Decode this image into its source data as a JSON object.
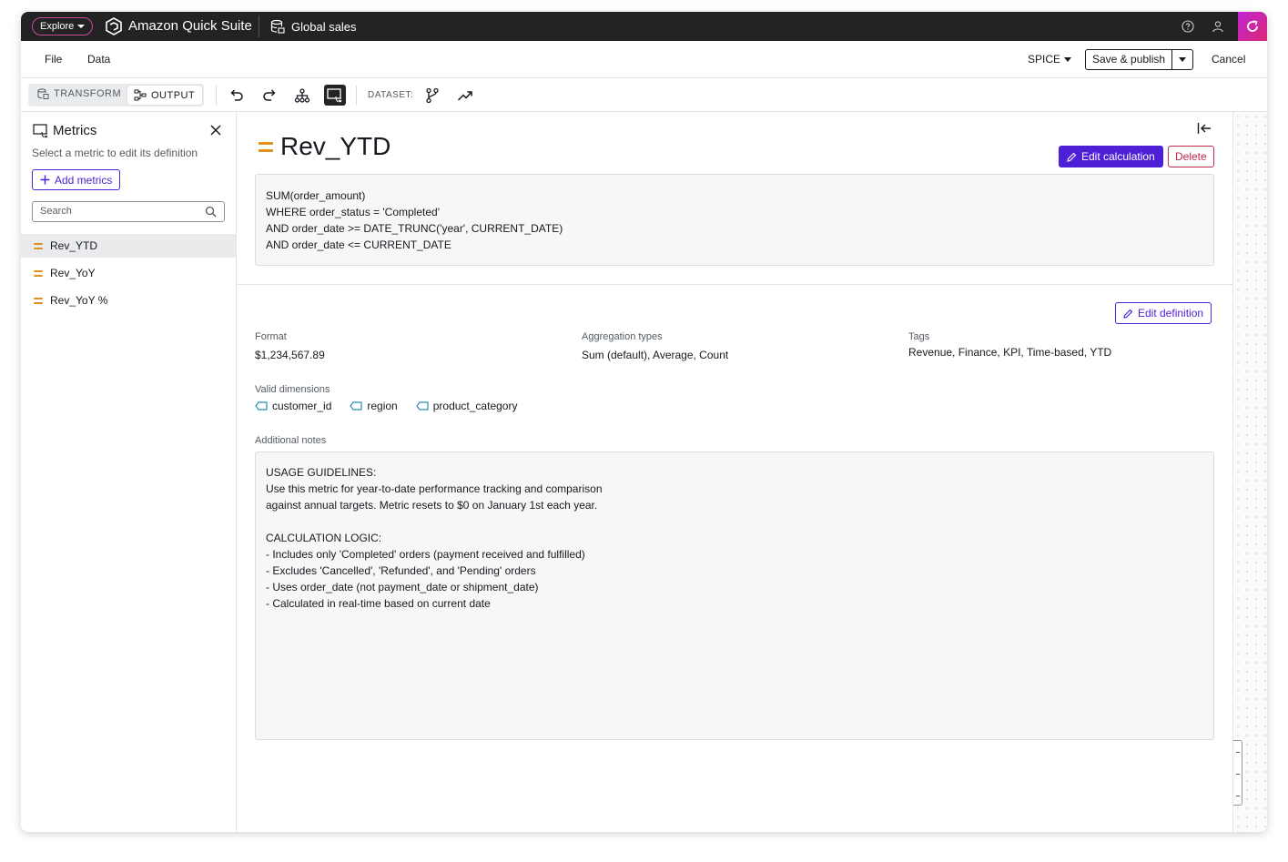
{
  "topbar": {
    "explore_label": "Explore",
    "app_title": "Amazon Quick Suite",
    "dataset_title": "Global sales"
  },
  "menubar": {
    "file": "File",
    "data": "Data",
    "spice": "SPICE",
    "save_publish": "Save & publish",
    "cancel": "Cancel"
  },
  "toolbar": {
    "transform": "TRANSFORM",
    "output": "OUTPUT",
    "dataset_label": "DATASET:"
  },
  "metrics_panel": {
    "title": "Metrics",
    "subtitle": "Select a metric to edit its definition",
    "add_button": "Add metrics",
    "search_placeholder": "Search",
    "items": [
      {
        "label": "Rev_YTD",
        "selected": true
      },
      {
        "label": "Rev_YoY",
        "selected": false
      },
      {
        "label": "Rev_YoY %",
        "selected": false
      }
    ]
  },
  "detail": {
    "name": "Rev_YTD",
    "edit_calculation": "Edit calculation",
    "delete": "Delete",
    "formula_lines": [
      "SUM(order_amount)",
      "WHERE order_status = 'Completed'",
      "AND order_date >= DATE_TRUNC('year', CURRENT_DATE)",
      "AND order_date <= CURRENT_DATE"
    ],
    "edit_definition": "Edit definition",
    "format_label": "Format",
    "format_value": "$1,234,567.89",
    "aggregation_label": "Aggregation types",
    "aggregation_value": "Sum (default), Average, Count",
    "tags_label": "Tags",
    "tags_value": "Revenue, Finance, KPI, Time-based, YTD",
    "dimensions_label": "Valid dimensions",
    "dimensions": [
      "customer_id",
      "region",
      "product_category"
    ],
    "notes_label": "Additional notes",
    "notes_lines": [
      "USAGE GUIDELINES:",
      "Use this metric for year-to-date performance tracking and comparison",
      "against annual targets. Metric resets to $0 on January 1st each year.",
      "",
      "CALCULATION LOGIC:",
      "- Includes only 'Completed' orders (payment received and fulfilled)",
      "- Excludes 'Cancelled', 'Refunded', and 'Pending' orders",
      "- Uses order_date (not payment_date or shipment_date)",
      "- Calculated in real-time based on current date"
    ]
  },
  "colors": {
    "accent": "#4d1fd6",
    "danger": "#c4284a",
    "metric_icon": "#e0901b",
    "topbar": "#232323"
  }
}
